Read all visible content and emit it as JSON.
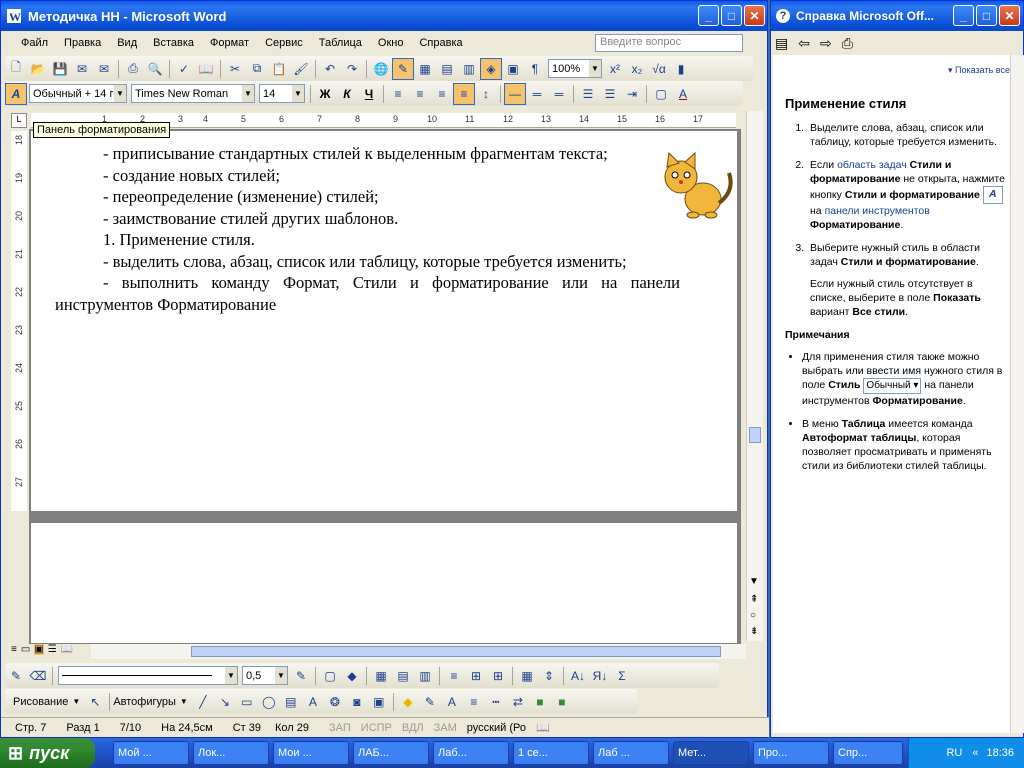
{
  "word": {
    "title": "Методичка НН - Microsoft Word",
    "menu": [
      "Файл",
      "Правка",
      "Вид",
      "Вставка",
      "Формат",
      "Сервис",
      "Таблица",
      "Окно",
      "Справка"
    ],
    "ask_placeholder": "Введите вопрос",
    "zoom": "100%",
    "style": "Обычный + 14 г",
    "font": "Times New Roman",
    "size": "14",
    "tooltip": "Панель форматирования",
    "ruler_numbers": [
      "1",
      "2",
      "3",
      "4",
      "5",
      "6",
      "7",
      "8",
      "9",
      "10",
      "11",
      "12",
      "13",
      "14",
      "15",
      "16",
      "17"
    ],
    "vruler_numbers": [
      "18",
      "19",
      "20",
      "21",
      "22",
      "23",
      "24",
      "25",
      "26",
      "27"
    ],
    "lines": [
      "- приписывание стандартных стилей к выделенным фрагментам текста;",
      "- создание новых стилей;",
      "- переопределение (изменение) стилей;",
      "- заимствование стилей других шаблонов.",
      "1. Применение стиля.",
      "- выделить слова, абзац, список или таблицу, которые требуется изменить;",
      "- выполнить команду Формат, Стили и форматирование или на панели инструментов Форматирование"
    ],
    "line_width": "0,5",
    "drawing_label": "Рисование",
    "autoshapes_label": "Автофигуры",
    "status": {
      "page": "Стр. 7",
      "section": "Разд 1",
      "pages": "7/10",
      "at": "На 24,5см",
      "line": "Ст 39",
      "col": "Кол 29",
      "rec": "ЗАП",
      "trk": "ИСПР",
      "ext": "ВДЛ",
      "ovr": "ЗАМ",
      "lang": "русский (Ро"
    }
  },
  "help": {
    "title": "Справка Microsoft Off...",
    "show_all": "Показать все",
    "heading": "Применение стиля",
    "step1": "Выделите слова, абзац, список или таблицу, которые требуется изменить.",
    "step2_a": "Если",
    "step2_link": "область задач",
    "step2_b": "Стили и форматирование",
    "step2_c": "не открыта, нажмите кнопку",
    "step2_d": "Стили и форматирование",
    "step2_e": "на",
    "step2_link2": "панели инструментов",
    "step2_f": "Форматирование",
    "step3_a": "Выберите нужный стиль в области задач",
    "step3_b": "Стили и форматирование",
    "step3_note_a": "Если нужный стиль отсутствует в списке, выберите в поле",
    "step3_note_b": "Показать",
    "step3_note_c": "вариант",
    "step3_note_d": "Все стили",
    "notes_title": "Примечания",
    "note1_a": "Для применения стиля также можно выбрать или ввести имя нужного стиля в поле",
    "note1_b": "Стиль",
    "note1_combo": "Обычный",
    "note1_c": "на панели инструментов",
    "note1_d": "Форматирование",
    "note2_a": "В меню",
    "note2_b": "Таблица",
    "note2_c": "имеется команда",
    "note2_d": "Автоформат таблицы",
    "note2_e": ", которая позволяет просматривать и применять стили из библиотеки стилей таблицы."
  },
  "taskbar": {
    "start": "пуск",
    "tasks": [
      "Мой ...",
      "Лок...",
      "Мои ...",
      "ЛАБ...",
      "Лаб...",
      "1 се...",
      "Лаб ...",
      "Мет...",
      "Про...",
      "Спр..."
    ],
    "lang": "RU",
    "time": "18:36"
  }
}
